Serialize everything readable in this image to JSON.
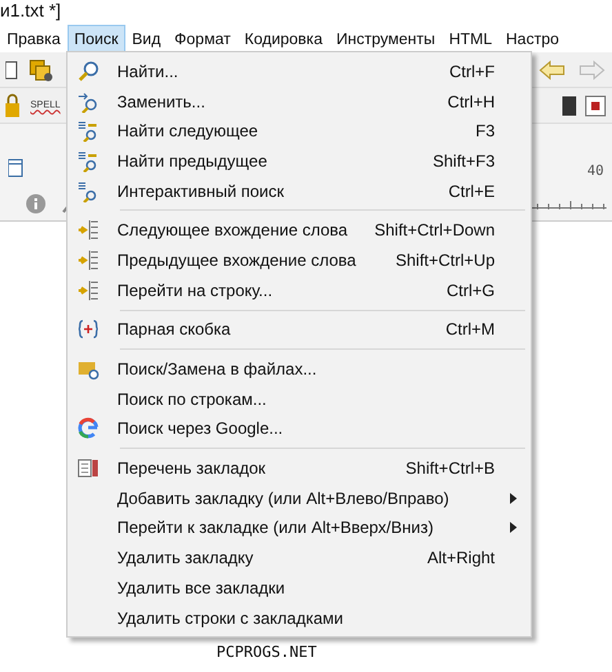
{
  "window": {
    "title": "и1.txt *]"
  },
  "menu_bar": [
    {
      "label": "Правка",
      "selected": false
    },
    {
      "label": "Поиск",
      "selected": true
    },
    {
      "label": "Вид",
      "selected": false
    },
    {
      "label": "Формат",
      "selected": false
    },
    {
      "label": "Кодировка",
      "selected": false
    },
    {
      "label": "Инструменты",
      "selected": false
    },
    {
      "label": "HTML",
      "selected": false
    },
    {
      "label": "Настро",
      "selected": false
    }
  ],
  "toolbar": {
    "spell_label": "SPELL"
  },
  "ruler": {
    "label": "40"
  },
  "dropdown": {
    "groups": [
      [
        {
          "label": "Найти...",
          "shortcut": "Ctrl+F",
          "submenu": false
        },
        {
          "label": "Заменить...",
          "shortcut": "Ctrl+H",
          "submenu": false
        },
        {
          "label": "Найти следующее",
          "shortcut": "F3",
          "submenu": false
        },
        {
          "label": "Найти предыдущее",
          "shortcut": "Shift+F3",
          "submenu": false
        },
        {
          "label": "Интерактивный поиск",
          "shortcut": "Ctrl+E",
          "submenu": false
        }
      ],
      [
        {
          "label": "Следующее вхождение слова",
          "shortcut": "Shift+Ctrl+Down",
          "submenu": false
        },
        {
          "label": "Предыдущее вхождение слова",
          "shortcut": "Shift+Ctrl+Up",
          "submenu": false
        },
        {
          "label": "Перейти на строку...",
          "shortcut": "Ctrl+G",
          "submenu": false
        }
      ],
      [
        {
          "label": "Парная скобка",
          "shortcut": "Ctrl+M",
          "submenu": false
        }
      ],
      [
        {
          "label": "Поиск/Замена в файлах...",
          "submenu": false
        },
        {
          "label": "Поиск по строкам...",
          "submenu": false
        },
        {
          "label": "Поиск через Google...",
          "submenu": false
        }
      ],
      [
        {
          "label": "Перечень закладок",
          "shortcut": "Shift+Ctrl+B",
          "submenu": false
        },
        {
          "label": "Добавить закладку (или Alt+Влево/Вправо)",
          "submenu": true
        },
        {
          "label": "Перейти к закладке (или Alt+Вверх/Вниз)",
          "submenu": true
        },
        {
          "label": "Удалить закладку",
          "shortcut": "Alt+Right",
          "submenu": false
        },
        {
          "label": "Удалить все закладки",
          "submenu": false
        },
        {
          "label": "Удалить строки с закладками",
          "submenu": false
        }
      ]
    ]
  },
  "editor": {
    "lines": [
      "PCPROGS.NET"
    ]
  }
}
